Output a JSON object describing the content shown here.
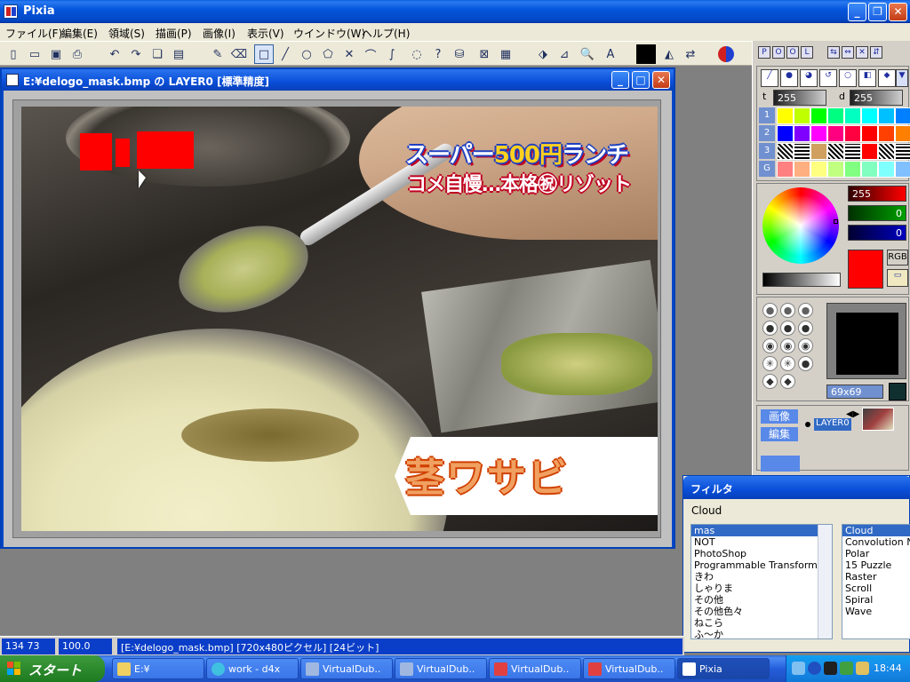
{
  "app": {
    "title": "Pixia"
  },
  "menu": [
    "ファイル(F)",
    "編集(E)",
    "領域(S)",
    "描画(P)",
    "画像(I)",
    "表示(V)",
    "ウインドウ(W)",
    "ヘルプ(H)"
  ],
  "document": {
    "title": "E:¥delogo_mask.bmp の LAYER0 [標準精度]",
    "caption_line1_a": "スーパー",
    "caption_line1_b": "500円",
    "caption_line1_c": "ランチ",
    "caption_line2": "コメ自慢…本格㊗リゾット",
    "caption_bubble": "茎ワサビ"
  },
  "palette_tabs": [
    "P",
    "O",
    "O",
    "L"
  ],
  "color_panel": {
    "t_label": "t",
    "t_value": "255",
    "d_label": "d",
    "d_value": "255",
    "row_labels": [
      "1",
      "2",
      "3",
      "G"
    ],
    "rgb": {
      "r": "255",
      "g": "0",
      "b": "0"
    },
    "rgb_button": "RGB",
    "colors": {
      "row1": [
        "#ffff00",
        "#c0ff00",
        "#00ff00",
        "#00ff80",
        "#00ffc0",
        "#00ffff",
        "#00c0ff",
        "#0080ff"
      ],
      "row2": [
        "#0000ff",
        "#8000ff",
        "#ff00ff",
        "#ff0080",
        "#ff0040",
        "#ff0000",
        "#ff4000",
        "#ff8000"
      ],
      "row4": [
        "#ff8080",
        "#ffb080",
        "#ffff80",
        "#c0ff80",
        "#80ff80",
        "#80ffc0",
        "#80ffff",
        "#80c0ff"
      ]
    }
  },
  "brush_panel": {
    "size_label": "69x69"
  },
  "layer_panel": {
    "image_btn": "画像",
    "edit_btn": "編集",
    "layer_name": "LAYER0"
  },
  "filter_dialog": {
    "title": "フィルタ",
    "selected": "Cloud",
    "categories": [
      "mas",
      "NOT",
      "PhotoShop",
      "Programmable Transform",
      "きわ",
      "しゃりま",
      "その他",
      "その他色々",
      "ねこら",
      "ふ～か"
    ],
    "filters": [
      "Cloud",
      "Convolution N",
      "Polar",
      "15 Puzzle",
      "Raster",
      "Scroll",
      "Spiral",
      "Wave"
    ]
  },
  "statusbar": {
    "coords": "134 73",
    "zoom": "100.0",
    "info": "[E:¥delogo_mask.bmp] [720x480ピクセル] [24ビット]"
  },
  "taskbar": {
    "start": "スタート",
    "tasks": [
      "E:¥",
      "work - d4x",
      "VirtualDub..",
      "VirtualDub..",
      "VirtualDub..",
      "VirtualDub..",
      "Pixia"
    ],
    "clock": "18:44"
  }
}
